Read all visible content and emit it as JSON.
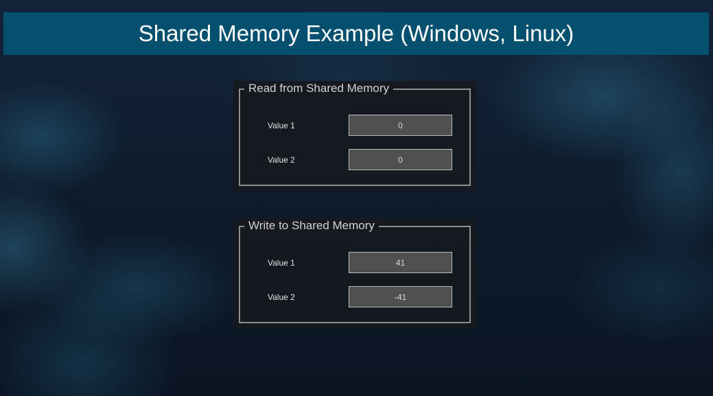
{
  "header": {
    "title": "Shared Memory Example (Windows, Linux)"
  },
  "read_panel": {
    "legend": "Read from Shared Memory",
    "rows": [
      {
        "label": "Value 1",
        "value": "0"
      },
      {
        "label": "Value 2",
        "value": "0"
      }
    ]
  },
  "write_panel": {
    "legend": "Write to Shared Memory",
    "rows": [
      {
        "label": "Value 1",
        "value": "41"
      },
      {
        "label": "Value 2",
        "value": "-41"
      }
    ]
  },
  "colors": {
    "title_bar": "#05506f",
    "panel_bg": "#16191e",
    "input_bg": "#505050",
    "border": "#8f8f8f"
  }
}
